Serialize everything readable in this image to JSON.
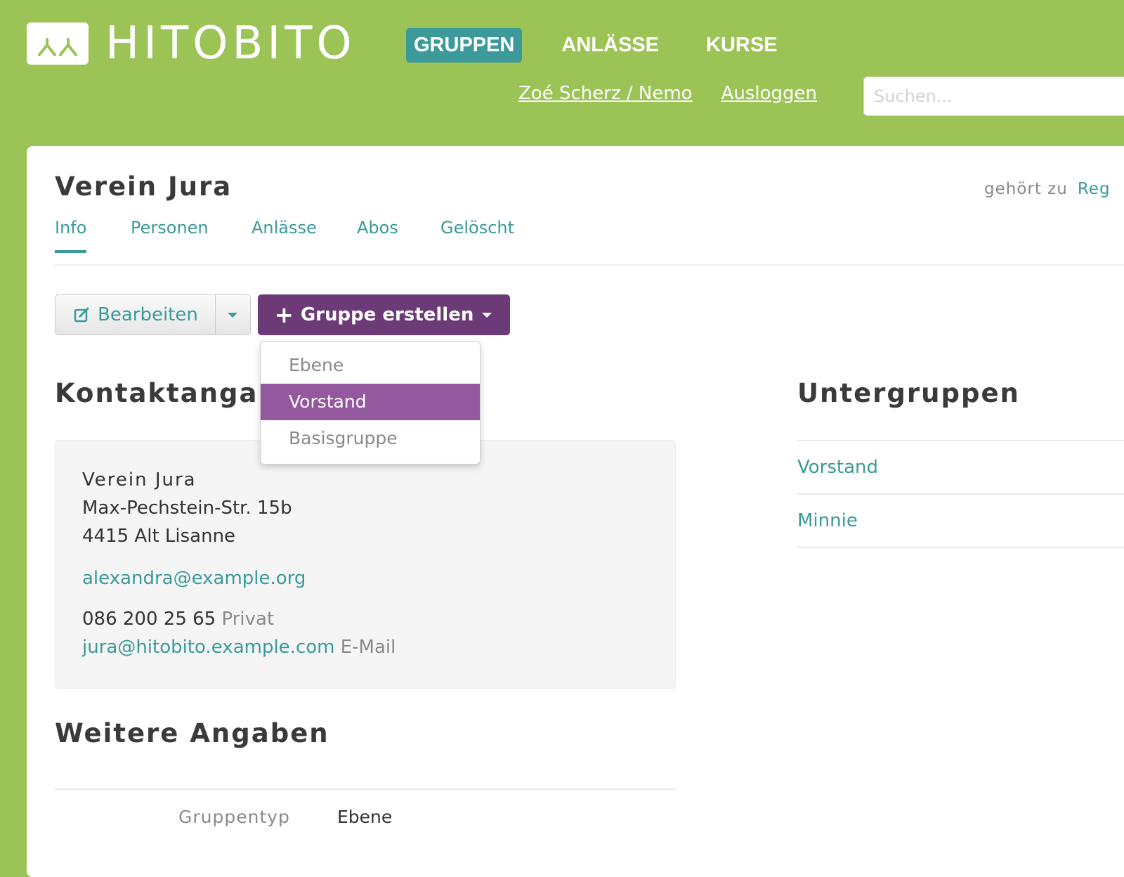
{
  "brand": {
    "name": "HITOBITO"
  },
  "nav": {
    "items": [
      {
        "label": "GRUPPEN",
        "active": true
      },
      {
        "label": "ANLÄSSE",
        "active": false
      },
      {
        "label": "KURSE",
        "active": false
      }
    ],
    "user_link": "Zoé Scherz / Nemo",
    "logout": "Ausloggen",
    "search_placeholder": "Suchen..."
  },
  "page": {
    "title": "Verein Jura",
    "belongs_label": "gehört zu",
    "belongs_link": "Reg"
  },
  "tabs": [
    {
      "label": "Info",
      "active": true
    },
    {
      "label": "Personen",
      "active": false
    },
    {
      "label": "Anlässe",
      "active": false
    },
    {
      "label": "Abos",
      "active": false
    },
    {
      "label": "Gelöscht",
      "active": false
    }
  ],
  "actions": {
    "edit_label": "Bearbeiten",
    "create_label": "Gruppe erstellen"
  },
  "dropdown": {
    "items": [
      {
        "label": "Ebene",
        "active": false
      },
      {
        "label": "Vorstand",
        "active": true
      },
      {
        "label": "Basisgruppe",
        "active": false
      }
    ]
  },
  "contact": {
    "heading": "Kontaktangab",
    "name": "Verein Jura",
    "street": "Max-Pechstein-Str. 15b",
    "city": "4415 Alt Lisanne",
    "email": "alexandra@example.org",
    "phone": "086 200 25 65",
    "phone_label": "Privat",
    "extra_email": "jura@hitobito.example.com",
    "extra_email_label": "E-Mail"
  },
  "subgroups": {
    "heading": "Untergruppen",
    "items": [
      "Vorstand",
      "Minnie"
    ]
  },
  "more": {
    "heading": "Weitere Angaben",
    "key": "Gruppentyp",
    "value": "Ebene"
  },
  "colors": {
    "header_bg": "#9bc356",
    "nav_active": "#3c9a9a",
    "link": "#3a9a9a",
    "primary_button": "#6c3a77",
    "dropdown_active": "#93589e"
  },
  "icons": [
    "logo-people-icon",
    "edit-icon",
    "caret-down-icon",
    "plus-icon"
  ]
}
